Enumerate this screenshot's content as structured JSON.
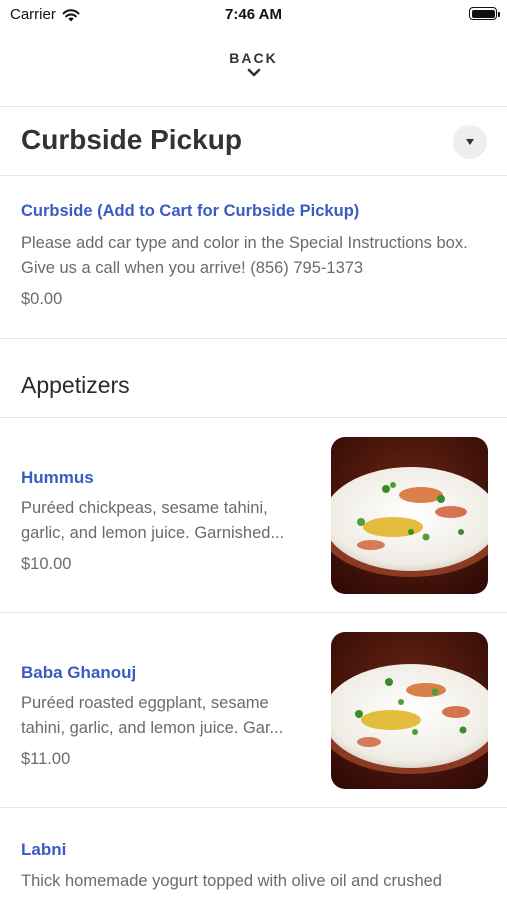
{
  "status_bar": {
    "carrier": "Carrier",
    "time": "7:46 AM"
  },
  "nav": {
    "back_label": "BACK"
  },
  "sections": [
    {
      "title": "Curbside Pickup",
      "items": [
        {
          "name": "Curbside (Add to Cart for Curbside Pickup)",
          "description": "Please add car type and color in the Special Instructions box. Give us a call when you arrive! (856) 795-1373",
          "price": "$0.00"
        }
      ]
    },
    {
      "title": "Appetizers",
      "items": [
        {
          "name": "Hummus",
          "description": "Puréed chickpeas, sesame tahini, garlic, and lemon juice. Garnished...",
          "price": "$10.00",
          "image": "hummus-photo"
        },
        {
          "name": "Baba Ghanouj",
          "description": "Puréed roasted eggplant, sesame tahini, garlic, and lemon juice. Gar...",
          "price": "$11.00",
          "image": "baba-ghanouj-photo"
        },
        {
          "name": "Labni",
          "description": "Thick homemade yogurt topped with olive oil and crushed"
        }
      ]
    }
  ],
  "colors": {
    "item_name": "#3b5bc4",
    "description": "#6b6b6b",
    "divider": "#e6e6e6"
  }
}
